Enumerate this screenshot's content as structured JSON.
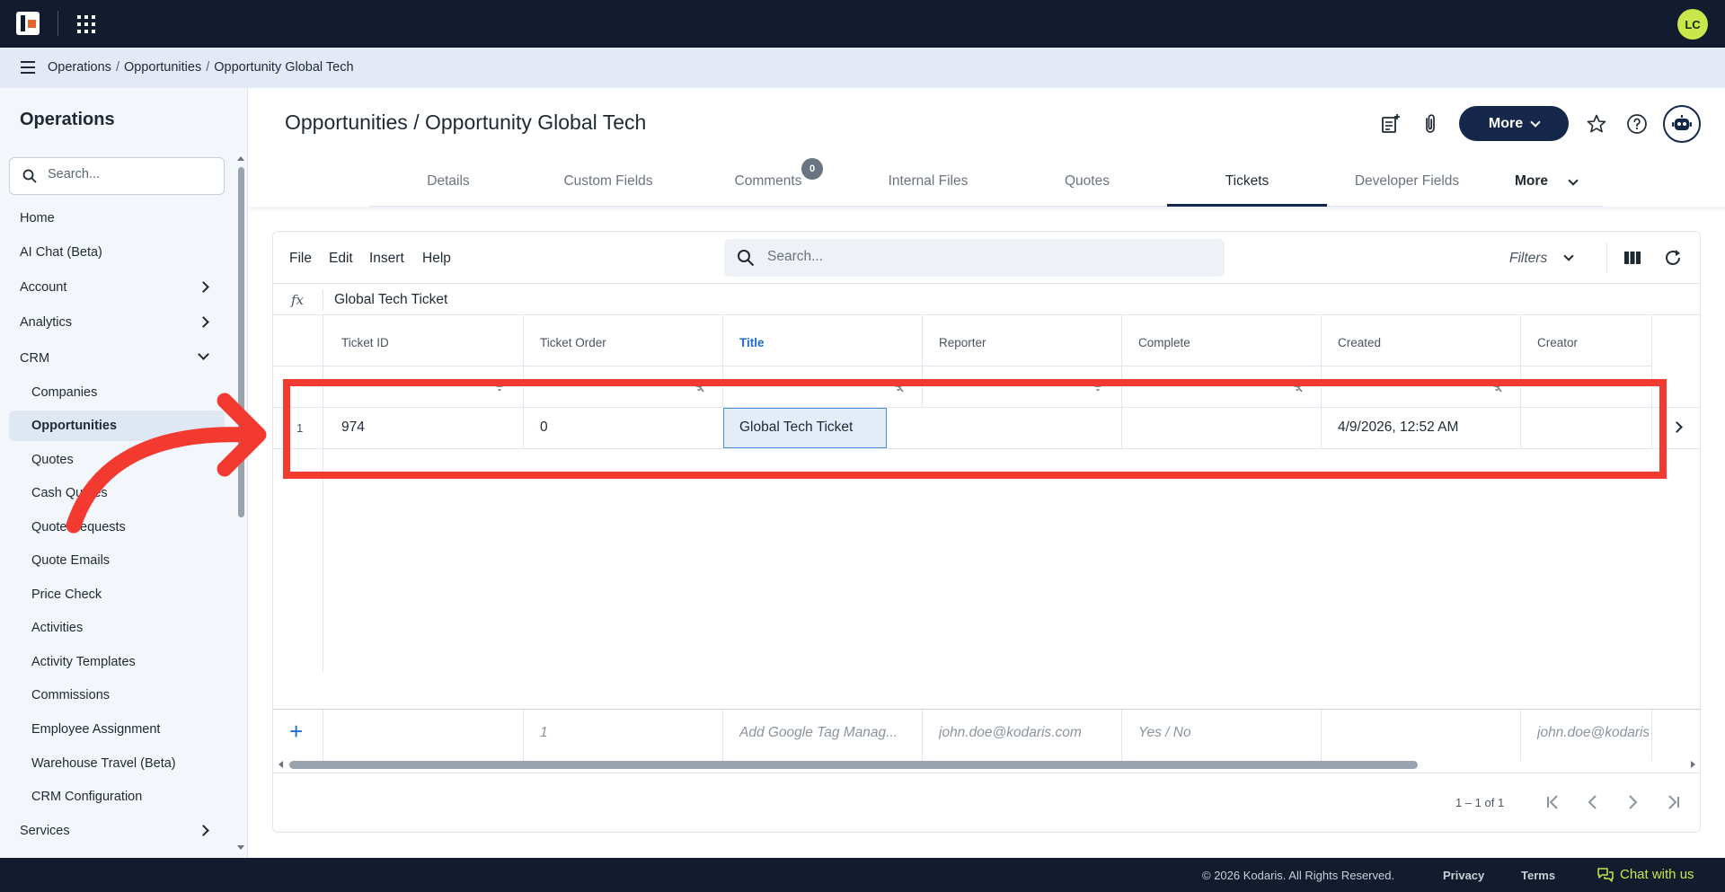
{
  "topbar": {
    "avatar_initials": "LC"
  },
  "breadcrumb": [
    "Operations",
    "Opportunities",
    "Opportunity Global Tech"
  ],
  "sidebar": {
    "title": "Operations",
    "search_placeholder": "Search...",
    "items": [
      {
        "label": "Home"
      },
      {
        "label": "AI Chat (Beta)"
      },
      {
        "label": "Account",
        "chevron": "right"
      },
      {
        "label": "Analytics",
        "chevron": "right"
      },
      {
        "label": "CRM",
        "chevron": "down"
      }
    ],
    "sub_items": [
      {
        "label": "Companies"
      },
      {
        "label": "Opportunities",
        "active": true
      },
      {
        "label": "Quotes"
      },
      {
        "label": "Cash Quotes"
      },
      {
        "label": "Quote Requests"
      },
      {
        "label": "Quote Emails"
      },
      {
        "label": "Price Check"
      },
      {
        "label": "Activities"
      },
      {
        "label": "Activity Templates"
      },
      {
        "label": "Commissions"
      },
      {
        "label": "Employee Assignment"
      },
      {
        "label": "Warehouse Travel (Beta)"
      },
      {
        "label": "CRM Configuration"
      }
    ],
    "bottom_item": {
      "label": "Services",
      "chevron": "right"
    }
  },
  "header": {
    "title": "Opportunities / Opportunity Global Tech",
    "more_label": "More",
    "icons": [
      "note-add-icon",
      "attachment-icon",
      "star-icon",
      "help-icon",
      "robot-icon"
    ]
  },
  "tabs": {
    "items": [
      {
        "label": "Details"
      },
      {
        "label": "Custom Fields"
      },
      {
        "label": "Comments",
        "badge": "0"
      },
      {
        "label": "Internal Files"
      },
      {
        "label": "Quotes"
      },
      {
        "label": "Tickets",
        "active": true
      },
      {
        "label": "Developer Fields"
      }
    ],
    "more_label": "More"
  },
  "grid": {
    "menu": [
      "File",
      "Edit",
      "Insert",
      "Help"
    ],
    "search_placeholder": "Search...",
    "filters_label": "Filters",
    "fx_label": "fx",
    "fx_value": "Global Tech Ticket",
    "columns": [
      "Ticket ID",
      "Ticket Order",
      "Title",
      "Reporter",
      "Complete",
      "Created",
      "Creator"
    ],
    "rows": [
      {
        "num": "1",
        "cells": [
          "974",
          "0",
          "Global Tech Ticket",
          "",
          "",
          "4/9/2026, 12:52 AM",
          ""
        ]
      }
    ],
    "new_row_placeholders": [
      "",
      "1",
      "Add Google Tag Manag...",
      "john.doe@kodaris.com",
      "Yes / No",
      "",
      "john.doe@kodaris.com"
    ],
    "pager_text": "1 – 1 of 1"
  },
  "footer": {
    "copyright": "© 2026 Kodaris. All Rights Reserved.",
    "privacy": "Privacy",
    "terms": "Terms",
    "chat": "Chat with us"
  },
  "colors": {
    "navy": "#131c2e",
    "accent": "#15284b",
    "highlight": "#f23a30",
    "link": "#1e6ad0"
  }
}
